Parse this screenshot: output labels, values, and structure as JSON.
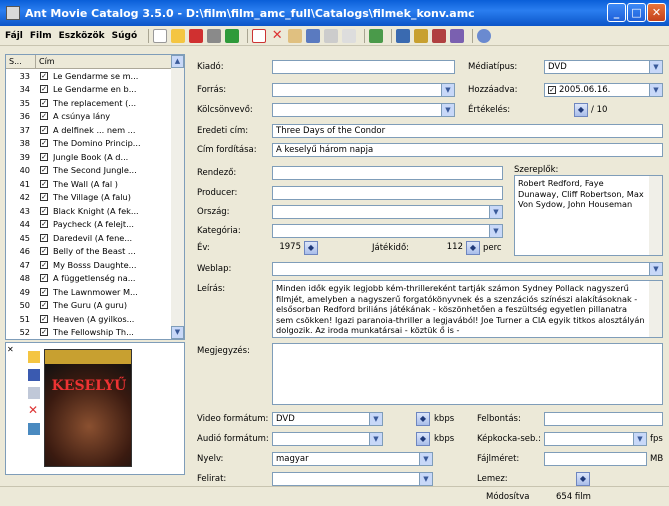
{
  "window": {
    "title": "Ant Movie Catalog 3.5.0 - D:\\film\\film_amc_full\\Catalogs\\filmek_konv.amc"
  },
  "menu": [
    "Fájl",
    "Film",
    "Eszközök",
    "Súgó"
  ],
  "list": {
    "headers": {
      "num": "S...",
      "title": "Cím"
    },
    "rows": [
      {
        "num": "33",
        "title": "Le Gendarme se m..."
      },
      {
        "num": "34",
        "title": "Le Gendarme en b..."
      },
      {
        "num": "35",
        "title": "The replacement (..."
      },
      {
        "num": "36",
        "title": "A csúnya lány"
      },
      {
        "num": "37",
        "title": "A delfinek ... nem ..."
      },
      {
        "num": "38",
        "title": "The Domino Princip..."
      },
      {
        "num": "39",
        "title": "Jungle Book (A d..."
      },
      {
        "num": "40",
        "title": "The Second Jungle..."
      },
      {
        "num": "41",
        "title": "The Wall (A fal )"
      },
      {
        "num": "42",
        "title": "The Village (A falu)"
      },
      {
        "num": "43",
        "title": "Black Knight (A fek..."
      },
      {
        "num": "44",
        "title": "Paycheck (A felejt..."
      },
      {
        "num": "45",
        "title": "Daredevil (A fene..."
      },
      {
        "num": "46",
        "title": "Belly of the Beast ..."
      },
      {
        "num": "47",
        "title": "My Bosss Daughte..."
      },
      {
        "num": "48",
        "title": "A függetlenség na..."
      },
      {
        "num": "49",
        "title": "The Lawnmower M..."
      },
      {
        "num": "50",
        "title": "The Guru (A guru)"
      },
      {
        "num": "51",
        "title": "Heaven (A gyilkos..."
      },
      {
        "num": "52",
        "title": "The Fellowship Th..."
      }
    ],
    "check_mark": "✓"
  },
  "poster": {
    "top_text": "KESELYŰ"
  },
  "fields": {
    "kiado_label": "Kiadó:",
    "kiado_value": "",
    "forras_label": "Forrás:",
    "forras_value": "",
    "kolcson_label": "Kölcsönvevő:",
    "kolcson_value": "",
    "eredeti_label": "Eredeti cím:",
    "eredeti_value": "Three Days of the Condor",
    "forditas_label": "Cím fordítása:",
    "forditas_value": "A keselyű három napja",
    "rendezo_label": "Rendező:",
    "rendezo_value": "",
    "producer_label": "Producer:",
    "producer_value": "",
    "orszag_label": "Ország:",
    "orszag_value": "",
    "kategoria_label": "Kategória:",
    "kategoria_value": "",
    "ev_label": "Év:",
    "ev_value": "1975",
    "jatekido_label": "Játékidő:",
    "jatekido_value": "112",
    "perc": "perc",
    "weblap_label": "Weblap:",
    "weblap_value": "",
    "leiras_label": "Leírás:",
    "leiras_value": "Minden idők egyik legjobb kém-thrillereként tartják számon Sydney Pollack nagyszerű filmjét, amelyben a nagyszerű forgatókönyvnek és a szenzációs színészi alakításoknak - elsősorban Redford briliáns játékának - köszönhetően a feszültség egyetlen pillanatra sem csökken! Igazi paranoia-thriller a legjavából! Joe Turner a CIA egyik titkos alosztályán dolgozik. Az iroda munkatársai - köztük ő is -",
    "megjegyzes_label": "Megjegyzés:",
    "mediatipus_label": "Médiatípus:",
    "mediatipus_value": "DVD",
    "hozzaadva_label": "Hozzáadva:",
    "hozzaadva_value": "2005.06.16.",
    "ertekeles_label": "Értékelés:",
    "ertekeles_value": "/ 10",
    "szereplok_label": "Szereplők:",
    "szereplok_value": "Robert Redford, Faye Dunaway, Cliff Robertson, Max Von Sydow, John Houseman",
    "video_label": "Video formátum:",
    "video_value": "DVD",
    "kbps1": "kbps",
    "audio_label": "Audió formátum:",
    "audio_value": "",
    "kbps2": "kbps",
    "nyelv_label": "Nyelv:",
    "nyelv_value": "magyar",
    "felirat_label": "Felirat:",
    "felirat_value": "",
    "felbontas_label": "Felbontás:",
    "felbontas_value": "",
    "kepkocka_label": "Képkocka-seb.:",
    "kepkocka_value": "",
    "fps": "fps",
    "fajlmeret_label": "Fájlméret:",
    "fajlmeret_value": "",
    "mb": "MB",
    "lemez_label": "Lemez:",
    "lemez_value": ""
  },
  "status": {
    "mode": "Módosítva",
    "count": "654 film"
  },
  "colors": {
    "titlebar": "#0a5fd8",
    "selection": "#316ac5"
  }
}
